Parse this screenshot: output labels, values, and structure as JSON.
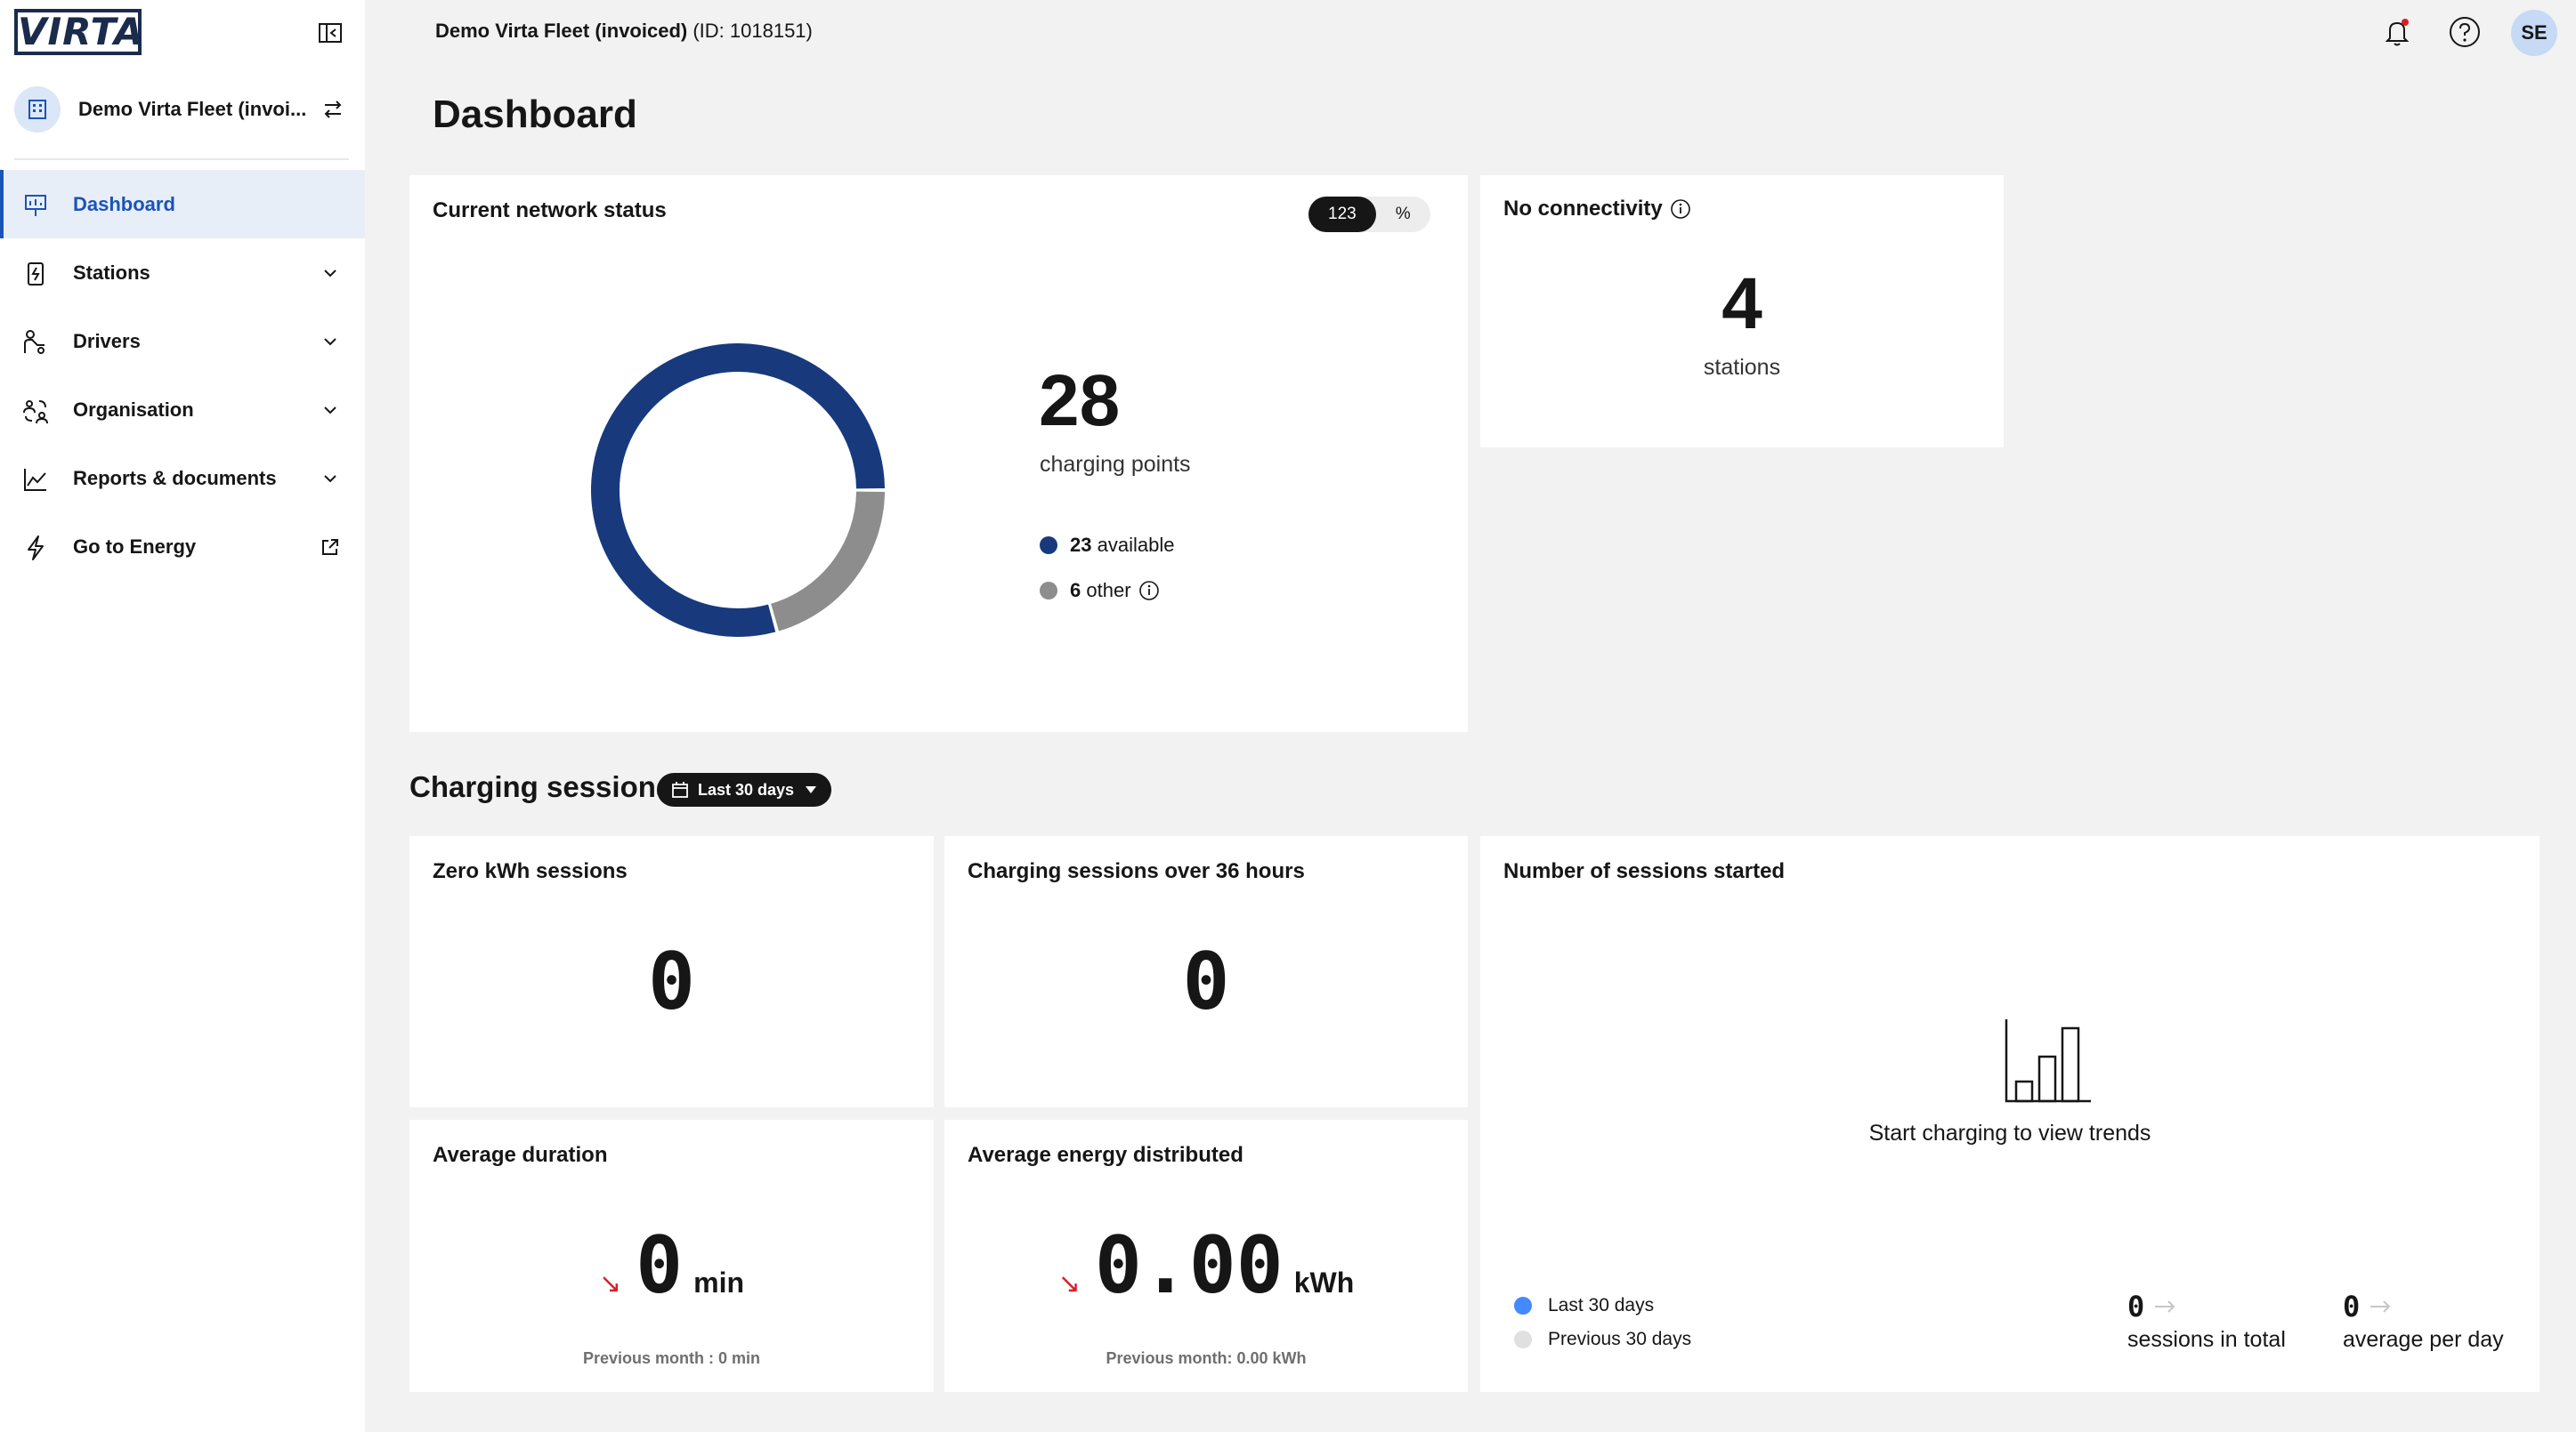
{
  "sidebar": {
    "logo_text": "VIRTA",
    "org_name": "Demo Virta Fleet (invoi...",
    "items": [
      {
        "label": "Dashboard",
        "icon": "dashboard-icon",
        "active": true
      },
      {
        "label": "Stations",
        "icon": "station-icon",
        "expandable": true
      },
      {
        "label": "Drivers",
        "icon": "driver-icon",
        "expandable": true
      },
      {
        "label": "Organisation",
        "icon": "organisation-icon",
        "expandable": true
      },
      {
        "label": "Reports & documents",
        "icon": "chart-icon",
        "expandable": true
      },
      {
        "label": "Go to Energy",
        "icon": "bolt-icon",
        "external": true
      }
    ]
  },
  "topbar": {
    "fleet_name": "Demo Virta Fleet (invoiced)",
    "fleet_id": "(ID: 1018151)",
    "user_initials": "SE"
  },
  "page_title": "Dashboard",
  "network_status": {
    "title": "Current network status",
    "toggle": [
      "123",
      "%"
    ],
    "toggle_selected": "123",
    "total": "28",
    "total_label": "charging points",
    "available_count": "23",
    "available_label": "available",
    "other_count": "6",
    "other_label": "other",
    "available_value": 23,
    "other_value": 6,
    "colors": {
      "available": "#183a7d",
      "other": "#8d8d8d"
    }
  },
  "no_connectivity": {
    "title": "No connectivity",
    "value": "4",
    "label": "stations"
  },
  "charging_sessions": {
    "title": "Charging sessions",
    "date_range": "Last 30 days"
  },
  "zero_kwh": {
    "title": "Zero kWh sessions",
    "value": "0"
  },
  "over_36h": {
    "title": "Charging sessions over 36 hours",
    "value": "0"
  },
  "avg_duration": {
    "title": "Average duration",
    "value": "0",
    "unit": "min",
    "previous": "Previous month : 0 min"
  },
  "avg_energy": {
    "title": "Average energy distributed",
    "value": "0.00",
    "unit": "kWh",
    "previous": "Previous month: 0.00 kWh"
  },
  "sessions_started": {
    "title": "Number of sessions started",
    "empty_text": "Start charging to view trends",
    "legend": [
      {
        "label": "Last 30 days",
        "color": "#4589ff"
      },
      {
        "label": "Previous 30 days",
        "color": "#e0e0e0"
      }
    ],
    "total_value": "0",
    "total_label": "sessions in total",
    "avg_value": "0",
    "avg_label": "average per day"
  }
}
